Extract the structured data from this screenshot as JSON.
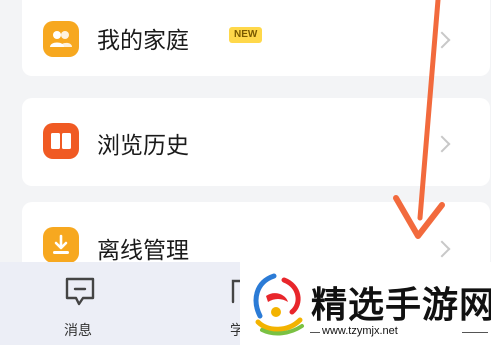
{
  "menu": {
    "family": {
      "label": "我的家庭",
      "badge": "NEW",
      "icon": "family-icon"
    },
    "history": {
      "label": "浏览历史",
      "icon": "book-icon"
    },
    "offline": {
      "label": "离线管理",
      "icon": "download-icon"
    }
  },
  "tabbar": {
    "messages": {
      "label": "消息",
      "icon": "message-icon"
    },
    "study": {
      "label": "学",
      "icon": "study-icon"
    }
  },
  "watermark": {
    "title": "精选手游网",
    "url": "www.tzymjx.net"
  },
  "colors": {
    "icon_orange": "#f7a81f",
    "icon_red": "#f05a23",
    "arrow": "#f26a3d",
    "badge_yellow": "#ffd84a"
  }
}
